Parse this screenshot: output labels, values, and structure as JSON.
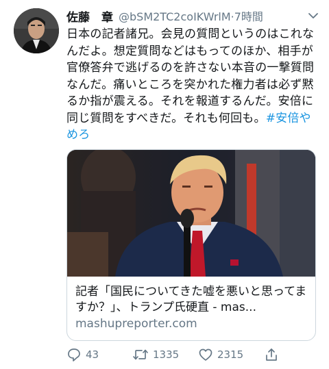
{
  "tweet": {
    "author_name": "佐藤　章",
    "handle": "@bSM2TC2coIKWrlM",
    "time": "·7時間",
    "body": "日本の記者諸兄。会見の質問というのはこれなんだよ。想定質問などはもってのほか、相手が官僚答弁で逃げるのを許さない本音の一撃質問なんだ。痛いところを突かれた権力者は必ず黙るか指が震える。それを報道するんだ。安倍に同じ質問をすべきだ。それも何回も。",
    "hashtag": "#安倍やめろ"
  },
  "card": {
    "title": "記者「国民についてきた嘘を悪いと思ってますか？」、トランプ氏硬直 - mas...",
    "domain": "mashupreporter.com"
  },
  "actions": {
    "replies": "43",
    "retweets": "1335",
    "likes": "2315"
  },
  "icons": [
    "avatar",
    "chevron-down-icon",
    "reply-icon",
    "retweet-icon",
    "like-icon",
    "share-icon"
  ]
}
